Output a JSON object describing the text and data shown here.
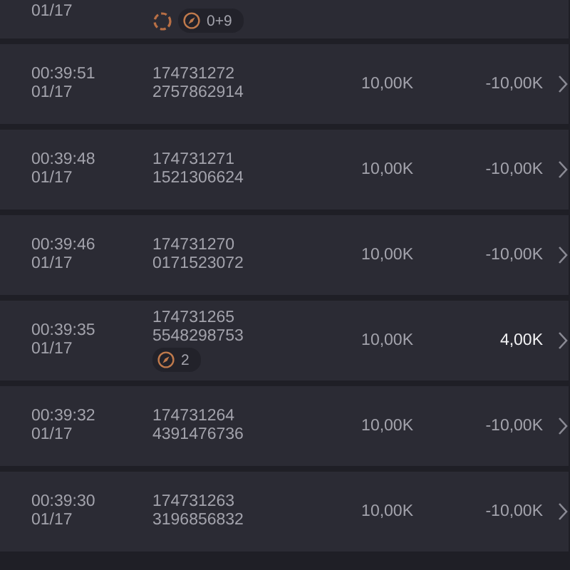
{
  "rows": [
    {
      "date": "01/17",
      "badges": [
        {
          "kind": "spinner"
        },
        {
          "kind": "count",
          "text": "0+9"
        }
      ],
      "partial": true
    },
    {
      "time": "00:39:51",
      "date": "01/17",
      "ids": [
        "174731272",
        "2757862914"
      ],
      "amount": "10,00K",
      "result": "-10,00K",
      "highlighted": false,
      "partial": false
    },
    {
      "time": "00:39:48",
      "date": "01/17",
      "ids": [
        "174731271",
        "1521306624"
      ],
      "amount": "10,00K",
      "result": "-10,00K",
      "highlighted": false,
      "partial": false
    },
    {
      "time": "00:39:46",
      "date": "01/17",
      "ids": [
        "174731270",
        "0171523072"
      ],
      "amount": "10,00K",
      "result": "-10,00K",
      "highlighted": false,
      "partial": false
    },
    {
      "time": "00:39:35",
      "date": "01/17",
      "ids": [
        "174731265",
        "5548298753"
      ],
      "badges": [
        {
          "kind": "count",
          "text": "2"
        }
      ],
      "amount": "10,00K",
      "result": "4,00K",
      "highlighted": true,
      "partial": false
    },
    {
      "time": "00:39:32",
      "date": "01/17",
      "ids": [
        "174731264",
        "4391476736"
      ],
      "amount": "10,00K",
      "result": "-10,00K",
      "highlighted": false,
      "partial": false
    },
    {
      "time": "00:39:30",
      "date": "01/17",
      "ids": [
        "174731263",
        "3196856832"
      ],
      "amount": "10,00K",
      "result": "-10,00K",
      "highlighted": false,
      "partial": false
    }
  ]
}
